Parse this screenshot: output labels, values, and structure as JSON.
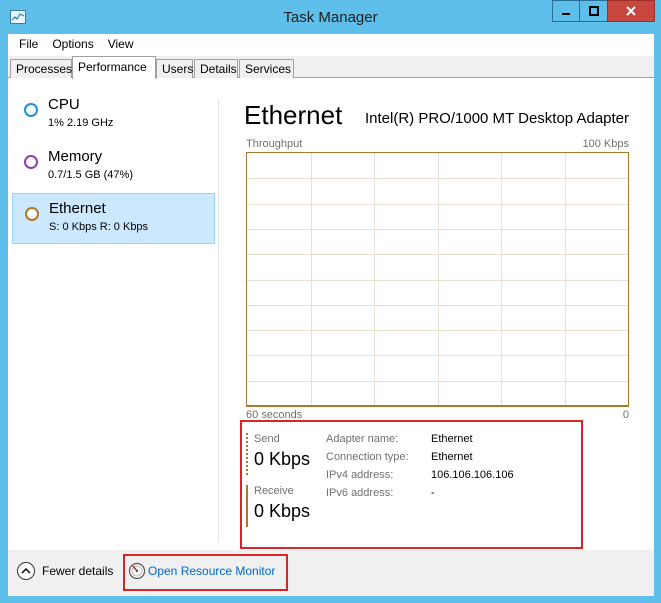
{
  "window": {
    "title": "Task Manager"
  },
  "menu": [
    {
      "label": "File"
    },
    {
      "label": "Options"
    },
    {
      "label": "View"
    }
  ],
  "tabs": [
    {
      "label": "Processes",
      "active": false
    },
    {
      "label": "Performance",
      "active": true
    },
    {
      "label": "Users",
      "active": false
    },
    {
      "label": "Details",
      "active": false
    },
    {
      "label": "Services",
      "active": false
    }
  ],
  "resources": [
    {
      "name": "CPU",
      "sub": "1% 2.19 GHz",
      "color": "#1e8fd6",
      "selected": false
    },
    {
      "name": "Memory",
      "sub": "0.7/1.5 GB (47%)",
      "color": "#8b3fb0",
      "selected": false
    },
    {
      "name": "Ethernet",
      "sub": "S: 0 Kbps R: 0 Kbps",
      "color": "#a97a2d",
      "selected": true
    }
  ],
  "detail": {
    "heading": "Ethernet",
    "adapter_desc": "Intel(R) PRO/1000 MT Desktop Adapter",
    "graph": {
      "title": "Throughput",
      "max_label": "100 Kbps",
      "time_label": "60 seconds",
      "min_label": "0",
      "line_color": "#a97a2d"
    },
    "send": {
      "label": "Send",
      "value": "0 Kbps"
    },
    "receive": {
      "label": "Receive",
      "value": "0 Kbps"
    },
    "properties": [
      {
        "key": "Adapter name:",
        "value": "Ethernet"
      },
      {
        "key": "Connection type:",
        "value": "Ethernet"
      },
      {
        "key": "IPv4 address:",
        "value": "106.106.106.106"
      },
      {
        "key": "IPv6 address:",
        "value": "-"
      }
    ]
  },
  "footer": {
    "fewer_details": "Fewer details",
    "open_resource_monitor": "Open Resource Monitor"
  }
}
